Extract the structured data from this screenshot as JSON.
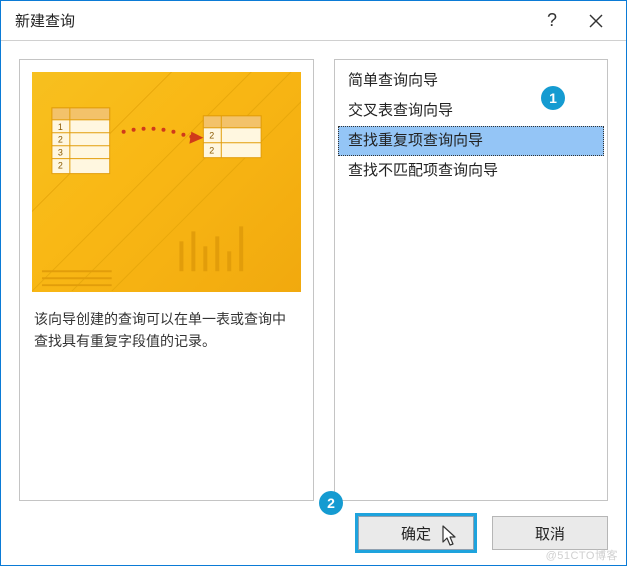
{
  "dialog": {
    "title": "新建查询",
    "help_label": "?",
    "close_label": "×"
  },
  "left": {
    "description": "该向导创建的查询可以在单一表或查询中查找具有重复字段值的记录。"
  },
  "list": {
    "items": [
      {
        "label": "简单查询向导",
        "selected": false
      },
      {
        "label": "交叉表查询向导",
        "selected": false
      },
      {
        "label": "查找重复项查询向导",
        "selected": true
      },
      {
        "label": "查找不匹配项查询向导",
        "selected": false
      }
    ]
  },
  "footer": {
    "ok_label": "确定",
    "cancel_label": "取消"
  },
  "callouts": {
    "c1": "1",
    "c2": "2"
  },
  "watermark": "@51CTO博客"
}
